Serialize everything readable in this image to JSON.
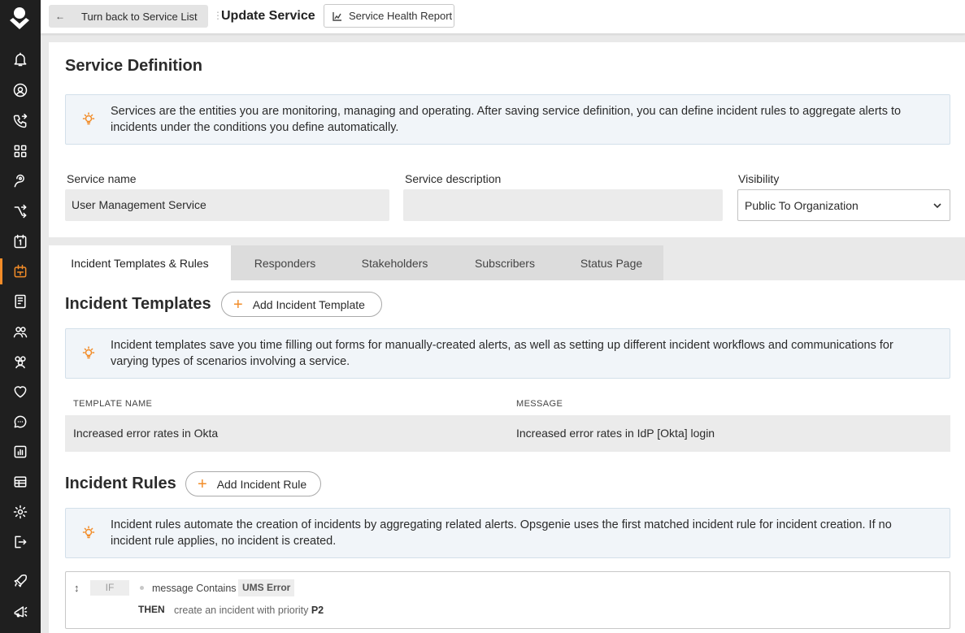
{
  "sidebar": {
    "icons": [
      "app-logo-icon",
      "bell-icon",
      "at-sign-icon",
      "phone-forward-icon",
      "integrations-icon",
      "heartbeat-icon",
      "routing-icon",
      "calendar-icon",
      "services-icon",
      "runbook-icon",
      "teams-icon",
      "users-icon",
      "heart-icon",
      "chat-icon",
      "analytics-icon",
      "table-icon",
      "settings-icon",
      "logout-icon",
      "rocket-icon",
      "megaphone-icon"
    ],
    "active": "services-icon",
    "accent": "#f28c28"
  },
  "header": {
    "back_label": "Turn back to Service List",
    "title": "Update Service",
    "health_report_label": "Service Health Report"
  },
  "definition": {
    "title": "Service Definition",
    "info": "Services are the entities you are monitoring, managing and operating. After saving service definition, you can define incident rules to aggregate alerts to incidents under the conditions you define automatically.",
    "name_label": "Service name",
    "name_value": "User Management Service",
    "description_label": "Service description",
    "description_value": "",
    "visibility_label": "Visibility",
    "visibility_value": "Public To Organization"
  },
  "tabs": [
    {
      "label": "Incident Templates & Rules",
      "active": true
    },
    {
      "label": "Responders",
      "active": false
    },
    {
      "label": "Stakeholders",
      "active": false
    },
    {
      "label": "Subscribers",
      "active": false
    },
    {
      "label": "Status Page",
      "active": false
    }
  ],
  "templates": {
    "title": "Incident Templates",
    "add_label": "Add Incident Template",
    "info": "Incident templates save you time filling out forms for manually-created alerts, as well as setting up different incident workflows and communications for varying types of scenarios involving a service.",
    "columns": [
      "TEMPLATE NAME",
      "MESSAGE"
    ],
    "rows": [
      {
        "name": "Increased error rates in Okta",
        "message": "Increased error rates in IdP [Okta] login"
      }
    ]
  },
  "rules": {
    "title": "Incident Rules",
    "add_label": "Add Incident Rule",
    "info": "Incident rules automate the creation of incidents by aggregating related alerts. Opsgenie uses the first matched incident rule for incident creation. If no incident rule applies, no incident is created.",
    "items": [
      {
        "if_label": "IF",
        "condition": "message Contains",
        "value": "UMS Error",
        "then_label": "THEN",
        "action": "create an incident with priority",
        "priority": "P2"
      }
    ]
  }
}
